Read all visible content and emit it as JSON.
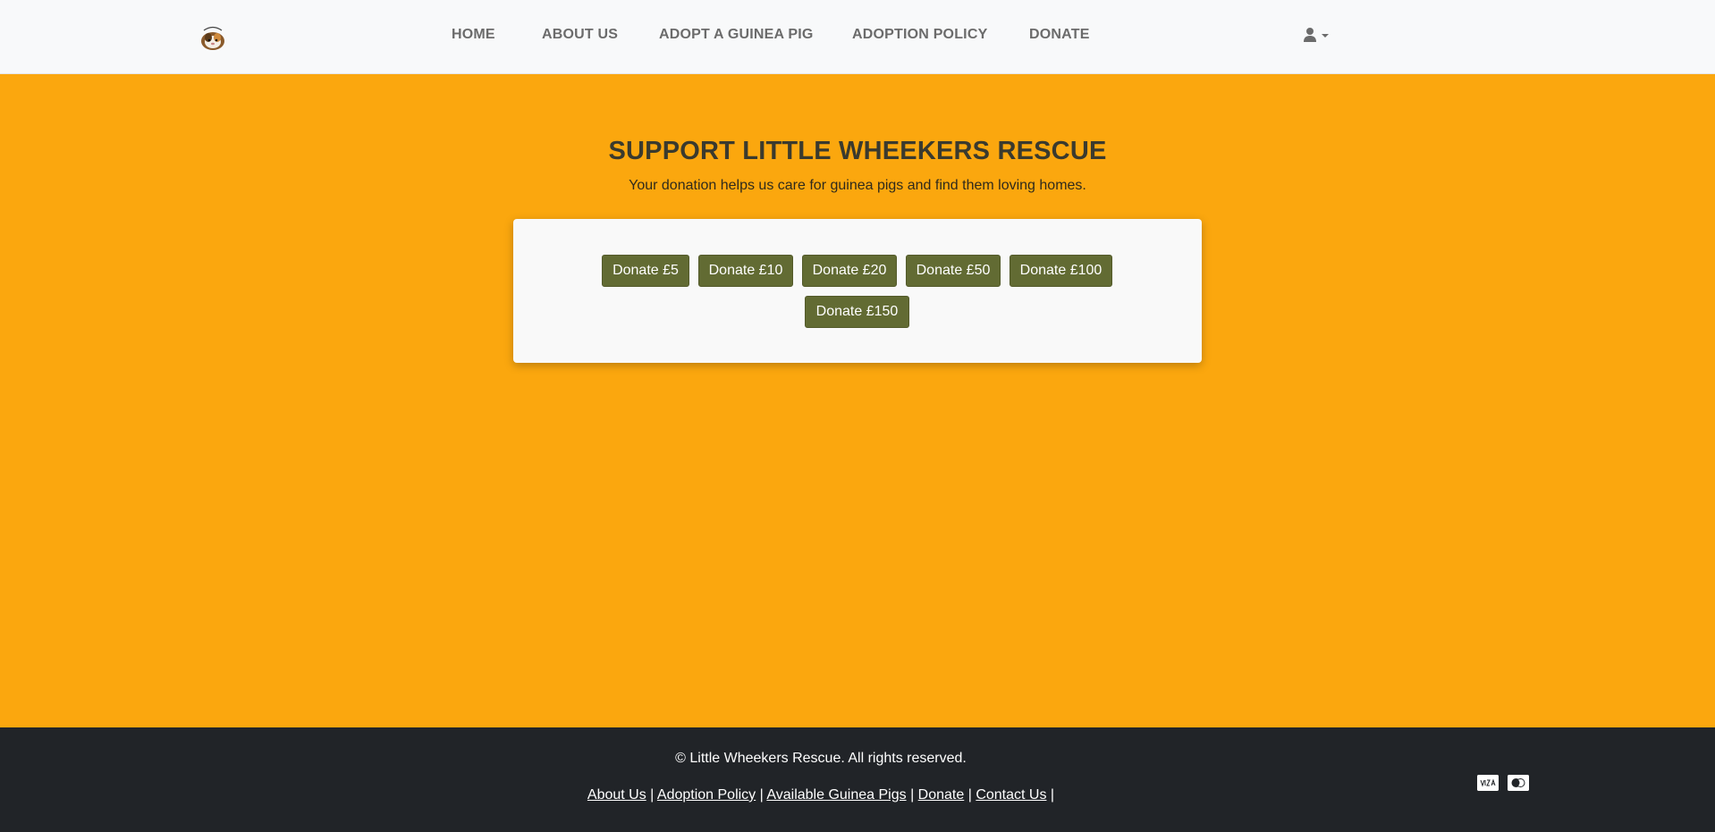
{
  "navbar": {
    "logo_alt": "Little Wheekers Rescue logo",
    "links": [
      {
        "label": "HOME"
      },
      {
        "label": "ABOUT US"
      },
      {
        "label": "ADOPT A GUINEA PIG"
      },
      {
        "label": "ADOPTION POLICY"
      },
      {
        "label": "DONATE"
      }
    ],
    "user_icon": "user-icon",
    "caret_icon": "caret-down-icon"
  },
  "hero": {
    "title": "SUPPORT LITTLE WHEEKERS RESCUE",
    "subtitle": "Your donation helps us care for guinea pigs and find them loving homes."
  },
  "donate": {
    "buttons": [
      {
        "label": "Donate £5"
      },
      {
        "label": "Donate £10"
      },
      {
        "label": "Donate £20"
      },
      {
        "label": "Donate £50"
      },
      {
        "label": "Donate £100"
      },
      {
        "label": "Donate £150"
      }
    ]
  },
  "footer": {
    "copyright": "© Little Wheekers Rescue. All rights reserved.",
    "links": [
      {
        "label": "About Us"
      },
      {
        "label": "Adoption Policy"
      },
      {
        "label": "Available Guinea Pigs"
      },
      {
        "label": "Donate"
      },
      {
        "label": "Contact Us"
      }
    ],
    "separator": "|",
    "payment_icons": [
      "visa-icon",
      "mastercard-icon"
    ]
  },
  "colors": {
    "page_background": "#fba70e",
    "navbar_background": "#f8f9fa",
    "nav_text": "#6b6b6b",
    "button_background": "#626b33",
    "footer_background": "#212428"
  }
}
